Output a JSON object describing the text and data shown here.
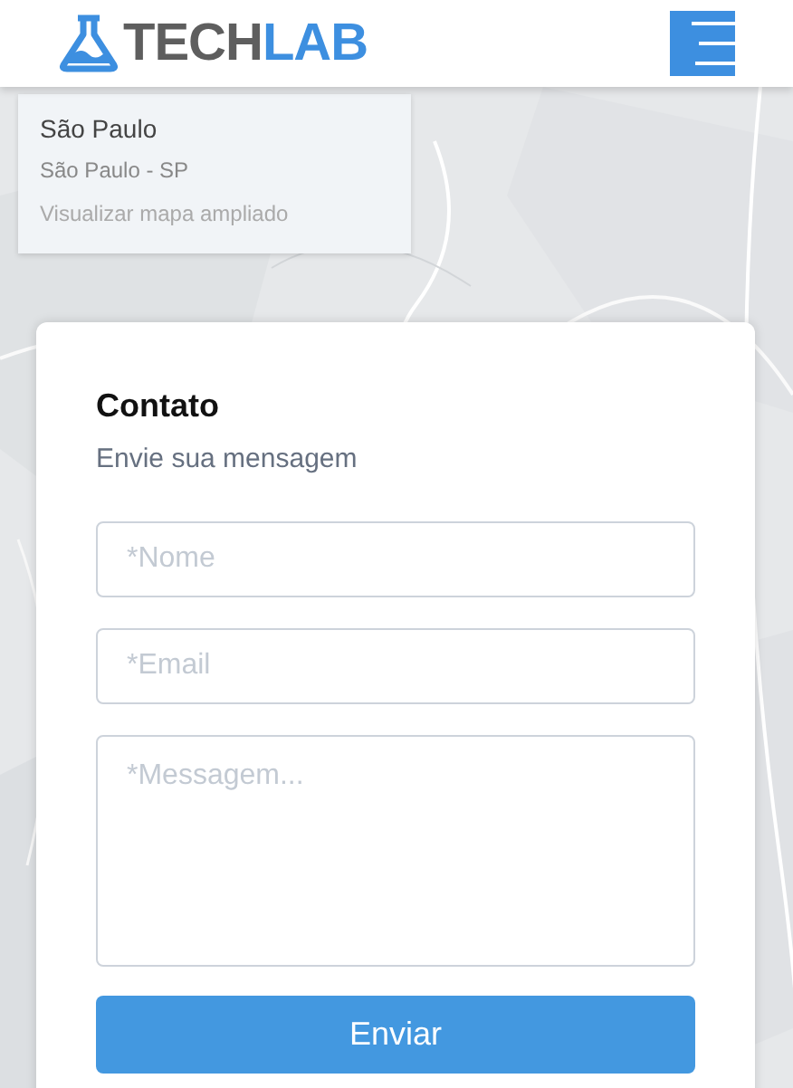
{
  "header": {
    "logo": {
      "first": "TECH",
      "second": "LAB"
    }
  },
  "map": {
    "info_card": {
      "title": "São Paulo",
      "subtitle": "São Paulo - SP",
      "link": "Visualizar mapa ampliado"
    }
  },
  "contact_form": {
    "title": "Contato",
    "subtitle": "Envie sua mensagem",
    "fields": [
      {
        "kind": "input",
        "placeholder": "*Nome"
      },
      {
        "kind": "input",
        "placeholder": "*Email"
      },
      {
        "kind": "textarea",
        "placeholder": "*Messagem..."
      }
    ],
    "submit": "Enviar"
  }
}
